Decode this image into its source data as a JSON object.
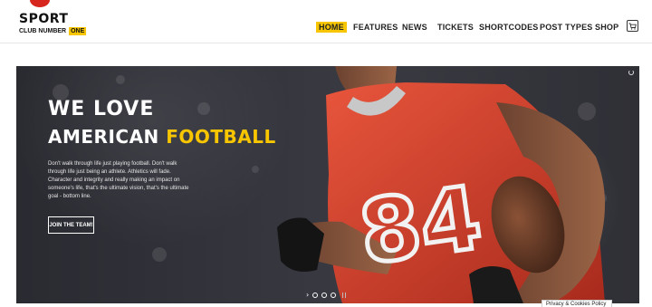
{
  "logo": {
    "title": "SPORT",
    "subtitle": "CLUB NUMBER",
    "subtitle_badge": "ONE"
  },
  "nav": {
    "items": [
      {
        "label": "HOME",
        "active": true
      },
      {
        "label": "FEATURES",
        "active": false
      },
      {
        "label": "NEWS",
        "active": false
      },
      {
        "label": "TICKETS",
        "active": false
      },
      {
        "label": "SHORTCODES",
        "active": false
      },
      {
        "label": "POST TYPES",
        "active": false
      },
      {
        "label": "SHOP",
        "active": false
      }
    ],
    "cart_icon": "cart-icon"
  },
  "hero": {
    "headline_line1": "WE LOVE",
    "headline_line2_a": "AMERICAN ",
    "headline_line2_b": "FOOTBALL",
    "body": "Don't walk through life just playing football. Don't walk through life just being an athlete. Athletics will fade. Character and integrity and really making an impact on someone's life, that's the ultimate vision, that's the ultimate goal - bottom line.",
    "cta_label": "JOIN THE TEAM!",
    "jersey_number": "84",
    "slider_arrow": "›"
  },
  "cookie_bar": {
    "label": "Privacy & Cookies Policy"
  },
  "colors": {
    "accent": "#f7c600",
    "jersey": "#d9432e",
    "logo_red": "#d7261e"
  }
}
